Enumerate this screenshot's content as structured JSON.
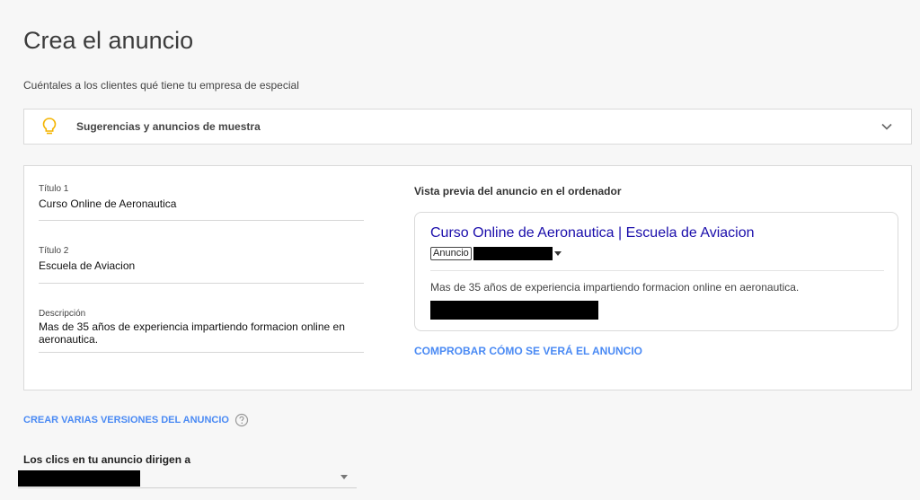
{
  "page": {
    "title": "Crea el anuncio",
    "subtitle": "Cuéntales a los clientes qué tiene tu empresa de especial"
  },
  "suggestions": {
    "label": "Sugerencias y anuncios de muestra",
    "icon": "lightbulb-icon",
    "expand_icon": "chevron-down-icon",
    "icon_color": "#f4b400"
  },
  "form": {
    "title1": {
      "label": "Título 1",
      "value": "Curso Online de Aeronautica"
    },
    "title2": {
      "label": "Título 2",
      "value": "Escuela de Aviacion"
    },
    "description": {
      "label": "Descripción",
      "value": "Mas de 35 años de experiencia impartiendo formacion online en aeronautica."
    }
  },
  "preview": {
    "heading": "Vista previa del anuncio en el ordenador",
    "headline": "Curso Online de Aeronautica | Escuela de Aviacion",
    "badge": "Anuncio",
    "description": "Mas de 35 años de experiencia impartiendo formacion online en aeronautica.",
    "headline_color": "#1a0dab",
    "check_link": "COMPROBAR CÓMO SE VERÁ EL ANUNCIO"
  },
  "versions": {
    "link": "CREAR VARIAS VERSIONES DEL ANUNCIO",
    "help_icon": "help-icon"
  },
  "final_url": {
    "label": "Los clics en tu anuncio dirigen a"
  },
  "colors": {
    "link": "#4a8af4",
    "background": "#f7f7f7",
    "card": "#ffffff"
  }
}
